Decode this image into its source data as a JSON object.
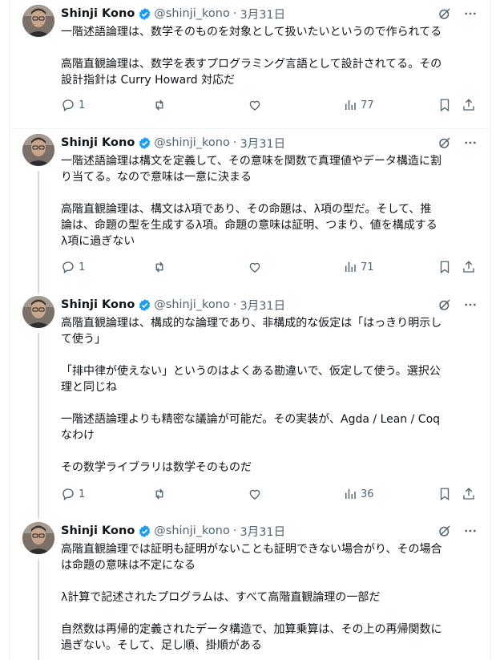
{
  "colors": {
    "accent": "#1d9bf0",
    "text": "#0f1419",
    "muted": "#536471",
    "border": "#eff3f4"
  },
  "icons": {
    "verified": "verified-badge-icon",
    "grok": "grok-icon",
    "more": "more-icon",
    "reply": "reply-icon",
    "retweet": "retweet-icon",
    "like": "heart-icon",
    "views": "views-icon",
    "bookmark": "bookmark-icon",
    "share": "share-icon"
  },
  "tweets": [
    {
      "name": "Shinji Kono",
      "handle": "@shinji_kono",
      "dot": "·",
      "date": "3月31日",
      "text": "一階述語論理は、数学そのものを対象として扱いたいというので作られてる\n\n高階直観論理は、数学を表すプログラミング言語として設計されてる。その\n設計指針は Curry Howard 対応だ",
      "replies": "1",
      "views": "77"
    },
    {
      "name": "Shinji Kono",
      "handle": "@shinji_kono",
      "dot": "·",
      "date": "3月31日",
      "text": "一階述語論理は構文を定義して、その意味を関数で真理値やデータ構造に割\nり当てる。なので意味は一意に決まる\n\n高階直観論理は、構文はλ項であり、その命題は、λ項の型だ。そして、推\n論は、命題の型を生成するλ項。命題の意味は証明、つまり、値を構成する\nλ項に過ぎない",
      "replies": "1",
      "views": "71"
    },
    {
      "name": "Shinji Kono",
      "handle": "@shinji_kono",
      "dot": "·",
      "date": "3月31日",
      "text": "高階直観論理は、構成的な論理であり、非構成的な仮定は「はっきり明示し\nて使う」\n\n「排中律が使えない」というのはよくある勘違いで、仮定して使う。選択公\n理と同じね\n\n一階述語論理よりも精密な議論が可能だ。その実装が、Agda / Lean / Coq\nなわけ\n\nその数学ライブラリは数学そのものだ",
      "replies": "1",
      "views": "36"
    },
    {
      "name": "Shinji Kono",
      "handle": "@shinji_kono",
      "dot": "·",
      "date": "3月31日",
      "text": "高階直観論理では証明も証明がないことも証明できない場合がり、その場合\nは命題の意味は不定になる\n\nλ計算で記述されたプログラムは、すべて高階直観論理の一部だ\n\n自然数は再帰的定義されたデータ構造で、加算乗算は、その上の再帰関数に\n過ぎない。そして、足し順、掛順がある"
    }
  ]
}
